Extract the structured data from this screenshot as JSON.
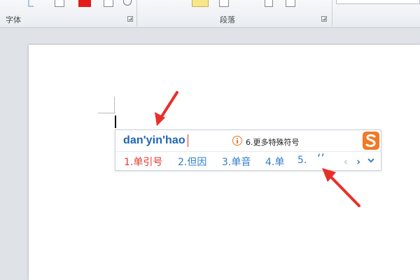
{
  "ribbon": {
    "group_font_label": "字体",
    "group_paragraph_label": "段落"
  },
  "ime": {
    "input_text": "dan'yin'hao",
    "more_symbols": "6.更多特殊符号",
    "candidates": [
      {
        "label": "1.单引号",
        "active": true
      },
      {
        "label": "2.但因",
        "active": false
      },
      {
        "label": "3.单音",
        "active": false
      },
      {
        "label": "4.单",
        "active": false
      },
      {
        "label": "5.",
        "active": false
      }
    ],
    "quote_candidate": "‘’",
    "prev_label": "‹",
    "next_label": "›",
    "logo_icon": "sogou-logo-icon",
    "info_icon": "info-icon"
  },
  "annotations": {
    "arrow_color": "#e8302a"
  }
}
